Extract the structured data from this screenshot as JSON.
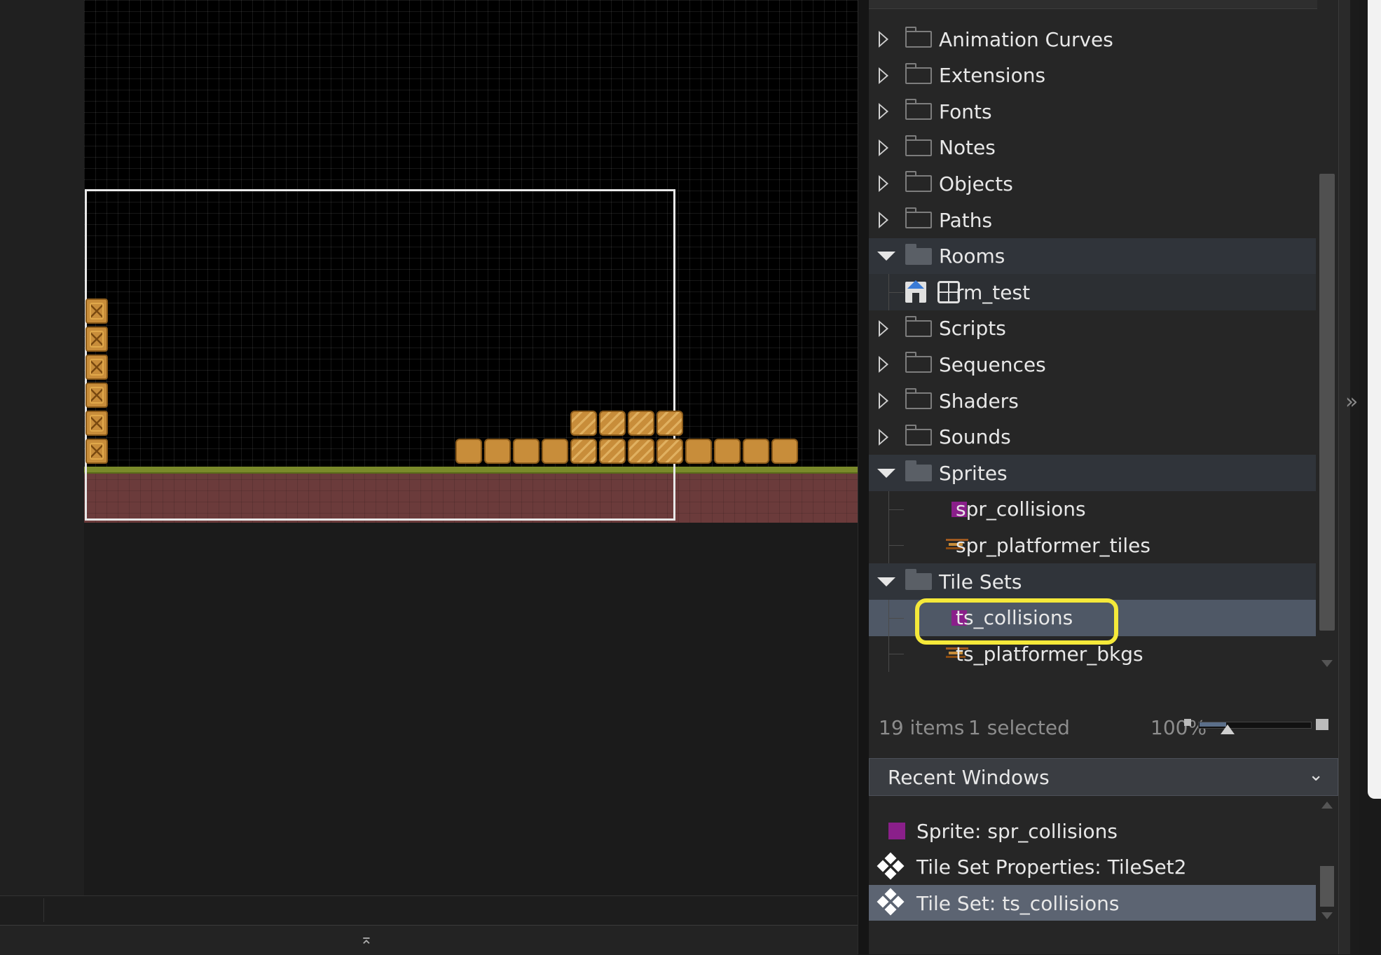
{
  "tree": {
    "items": [
      {
        "label": "Animation Curves",
        "kind": "folder",
        "state": "closed"
      },
      {
        "label": "Extensions",
        "kind": "folder",
        "state": "closed"
      },
      {
        "label": "Fonts",
        "kind": "folder",
        "state": "closed"
      },
      {
        "label": "Notes",
        "kind": "folder",
        "state": "closed"
      },
      {
        "label": "Objects",
        "kind": "folder",
        "state": "closed"
      },
      {
        "label": "Paths",
        "kind": "folder",
        "state": "closed"
      },
      {
        "label": "Rooms",
        "kind": "folder",
        "state": "open"
      },
      {
        "label": "rm_test",
        "kind": "room"
      },
      {
        "label": "Scripts",
        "kind": "folder",
        "state": "closed"
      },
      {
        "label": "Sequences",
        "kind": "folder",
        "state": "closed"
      },
      {
        "label": "Shaders",
        "kind": "folder",
        "state": "closed"
      },
      {
        "label": "Sounds",
        "kind": "folder",
        "state": "closed"
      },
      {
        "label": "Sprites",
        "kind": "folder",
        "state": "open"
      },
      {
        "label": "spr_collisions",
        "kind": "sprite"
      },
      {
        "label": "spr_platformer_tiles",
        "kind": "sprite"
      },
      {
        "label": "Tile Sets",
        "kind": "folder",
        "state": "open"
      },
      {
        "label": "ts_collisions",
        "kind": "tileset",
        "selected": true
      },
      {
        "label": "ts_platformer_bkgs",
        "kind": "tileset"
      }
    ]
  },
  "info": {
    "item_count": "19 items",
    "selected_count": "1 selected",
    "zoom": "100%"
  },
  "recent": {
    "title": "Recent Windows",
    "items": [
      {
        "label": "Sprite: spr_collisions",
        "icon": "sprite-icon"
      },
      {
        "label": "Tile Set Properties: TileSet2",
        "icon": "tileset-icon"
      },
      {
        "label": "Tile Set: ts_collisions",
        "icon": "tileset-icon",
        "active": true
      }
    ]
  },
  "colors": {
    "highlight": "#f5e93a",
    "selection": "#4f5866",
    "sprite_purple": "#8a1f8a"
  }
}
